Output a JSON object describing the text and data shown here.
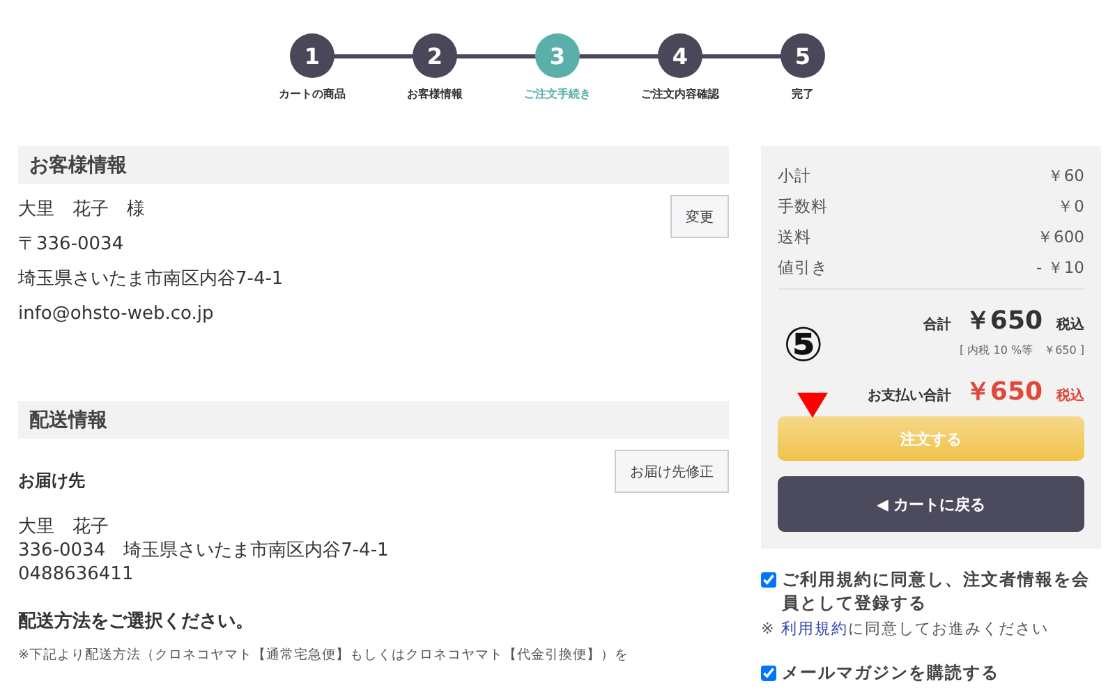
{
  "steps": [
    {
      "number": "1",
      "label": "カートの商品",
      "selected": false
    },
    {
      "number": "2",
      "label": "お客様情報",
      "selected": false
    },
    {
      "number": "3",
      "label": "ご注文手続き",
      "selected": true
    },
    {
      "number": "4",
      "label": "ご注文内容確認",
      "selected": false
    },
    {
      "number": "5",
      "label": "完了",
      "selected": false
    }
  ],
  "customer": {
    "heading": "お客様情報",
    "lines": [
      "大里　花子　様",
      "〒336-0034",
      "埼玉県さいたま市南区内谷7-4-1",
      "info@ohsto-web.co.jp"
    ],
    "button": "変更"
  },
  "shipping": {
    "heading": "配送情報",
    "subheading": "お届け先",
    "button": "お届け先修正",
    "lines": [
      "大里　花子",
      "336-0034　埼玉県さいたま市南区内谷7-4-1",
      "0488636411"
    ],
    "method_heading": "配送方法をご選択ください。",
    "note": "※下記より配送方法（クロネコヤマト【通常宅急便】もしくはクロネコヤマト【代金引換便】）を"
  },
  "summary": {
    "rows": [
      {
        "label": "小計",
        "value": "￥60"
      },
      {
        "label": "手数料",
        "value": "￥0"
      },
      {
        "label": "送料",
        "value": "￥600"
      },
      {
        "label": "値引き",
        "value": "- ￥10"
      }
    ],
    "total_label": "合計",
    "total": "￥650",
    "total_suffix": "税込",
    "tax_note": "[ 内税 10 %等　￥650 ]",
    "pay_label": "お支払い合計",
    "pay_total": "￥650",
    "pay_suffix": "税込",
    "order_button": "注文する",
    "back_button": "◀ カートに戻る"
  },
  "annotation": {
    "mark": "⑤"
  },
  "options": [
    {
      "label": "ご利用規約に同意し、注文者情報を会員として登録する",
      "checked": true,
      "note_prefix": "※ ",
      "note_link": "利用規約",
      "note_rest": "に同意してお進みください"
    },
    {
      "label": "メールマガジンを購読する",
      "checked": true
    }
  ]
}
